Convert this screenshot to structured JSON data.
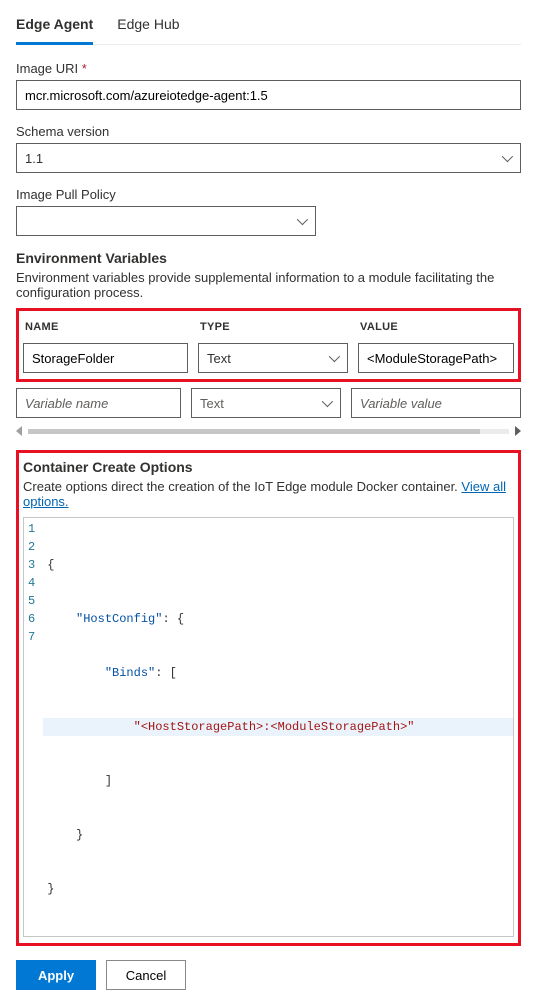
{
  "tabs": {
    "edge_agent": "Edge Agent",
    "edge_hub": "Edge Hub"
  },
  "image_uri": {
    "label": "Image URI",
    "required_mark": "*",
    "value": "mcr.microsoft.com/azureiotedge-agent:1.5"
  },
  "schema_version": {
    "label": "Schema version",
    "value": "1.1"
  },
  "image_pull_policy": {
    "label": "Image Pull Policy",
    "value": ""
  },
  "env_vars": {
    "title": "Environment Variables",
    "desc": "Environment variables provide supplemental information to a module facilitating the configuration process.",
    "headers": {
      "name": "NAME",
      "type": "TYPE",
      "value": "VALUE"
    },
    "rows": [
      {
        "name": "StorageFolder",
        "type": "Text",
        "value": "<ModuleStoragePath>"
      }
    ],
    "placeholder_row": {
      "name": "Variable name",
      "type": "Text",
      "value": "Variable value"
    }
  },
  "container_create": {
    "title": "Container Create Options",
    "desc": "Create options direct the creation of the IoT Edge module Docker container. ",
    "link": "View all options.",
    "code_lines": [
      {
        "n": 1,
        "text": "{"
      },
      {
        "n": 2,
        "text": "    \"HostConfig\": {"
      },
      {
        "n": 3,
        "text": "        \"Binds\": ["
      },
      {
        "n": 4,
        "text": "            \"<HostStoragePath>:<ModuleStoragePath>\""
      },
      {
        "n": 5,
        "text": "        ]"
      },
      {
        "n": 6,
        "text": "    }"
      },
      {
        "n": 7,
        "text": "}"
      }
    ]
  },
  "actions": {
    "apply": "Apply",
    "cancel": "Cancel"
  }
}
